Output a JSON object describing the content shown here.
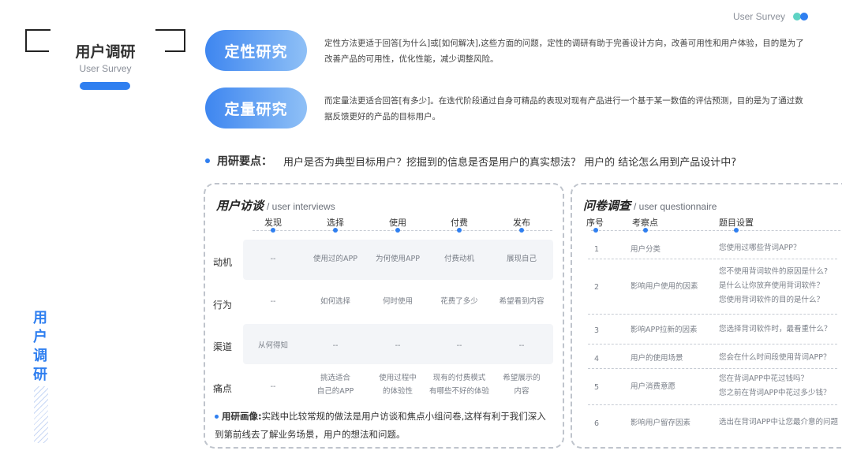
{
  "header": {
    "brand": "User Survey"
  },
  "title": {
    "main": "用户调研",
    "sub": "User Survey",
    "vertical": [
      "用",
      "户",
      "调",
      "研"
    ]
  },
  "methods": [
    {
      "label": "定性研究",
      "desc": "定性方法更适于回答[为什么]或[如何解决],这些方面的问题，定性的调研有助于完善设计方向，改善可用性和用户体验，目的是为了改善产品的可用性，优化性能，减少调整风险。"
    },
    {
      "label": "定量研究",
      "desc": "而定量法更适合回答[有多少]。在迭代阶段通过自身可精品的表现对现有产品进行一个基于某一数值的评估预测，目的是为了通过数据反馈更好的产品的目标用户。"
    }
  ],
  "key_points": {
    "label": "用研要点：",
    "text": "用户是否为典型目标用户？挖掘到的信息是否是用户的真实想法？ 用户的 结论怎么用到产品设计中?"
  },
  "interviews": {
    "title_cn": "用户访谈",
    "title_en": "/ user interviews",
    "stages": [
      "发现",
      "选择",
      "使用",
      "付费",
      "发布"
    ],
    "rows": [
      {
        "label": "动机",
        "cells": [
          "--",
          "使用过的APP",
          "为何使用APP",
          "付费动机",
          "展现自己"
        ]
      },
      {
        "label": "行为",
        "cells": [
          "--",
          "如何选择",
          "何时使用",
          "花费了多少",
          "希望看到内容"
        ]
      },
      {
        "label": "渠道",
        "cells": [
          "从何得知",
          "--",
          "--",
          "--",
          "--"
        ]
      },
      {
        "label": "痛点",
        "cells": [
          "--",
          "挑选适合\n自己的APP",
          "使用过程中\n的体验性",
          "现有的付费模式\n有哪些不好的体验",
          "希望展示的\n内容"
        ]
      }
    ],
    "note_label": "用研画像:",
    "note_text": "实践中比较常规的做法是用户访谈和焦点小组问卷,这样有利于我们深入到第前线去了解业务场景，用户的想法和问题。"
  },
  "questionnaire": {
    "title_cn": "问卷调查",
    "title_en": "/ user questionnaire",
    "columns": [
      "序号",
      "考察点",
      "题目设置"
    ],
    "rows": [
      {
        "no": "1",
        "point": "用户分类",
        "questions": [
          "您使用过哪些背词APP？"
        ]
      },
      {
        "no": "2",
        "point": "影响用户使用的因素",
        "questions": [
          "您不使用背词软件的原因是什么?",
          "是什么让你放弃使用背词软件？",
          "您使用背词软件的目的是什么？"
        ]
      },
      {
        "no": "3",
        "point": "影响APP拉新的因素",
        "questions": [
          "您选择背词软件时，最看重什么？"
        ]
      },
      {
        "no": "4",
        "point": "用户的使用场景",
        "questions": [
          "您会在什么时间段使用背词APP？"
        ]
      },
      {
        "no": "5",
        "point": "用户消费意愿",
        "questions": [
          "您在背词APP中花过钱吗？",
          "您之前在背词APP中花过多少钱？"
        ]
      },
      {
        "no": "6",
        "point": "影响用户留存因素",
        "questions": [
          "选出在背词APP中让您最介意的问题"
        ]
      }
    ]
  },
  "colors": {
    "accent": "#2f7ff0",
    "accent_light": "#8fc0f6",
    "teal": "#5ed3c4"
  },
  "icons": {
    "brand_dots": "two-circles-icon",
    "bullet": "dot-icon"
  }
}
